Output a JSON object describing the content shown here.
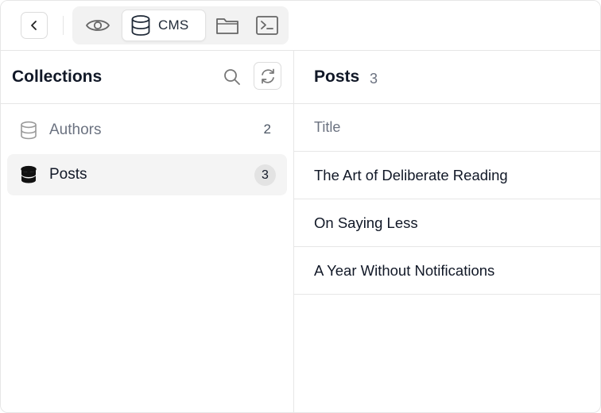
{
  "toolbar": {
    "tabs": [
      {
        "icon": "eye-icon",
        "label": ""
      },
      {
        "icon": "database-icon",
        "label": "CMS",
        "active": true
      },
      {
        "icon": "folder-icon",
        "label": ""
      },
      {
        "icon": "terminal-icon",
        "label": ""
      }
    ]
  },
  "sidebar": {
    "title": "Collections",
    "collections": [
      {
        "label": "Authors",
        "count": "2",
        "active": false
      },
      {
        "label": "Posts",
        "count": "3",
        "active": true
      }
    ]
  },
  "main": {
    "title": "Posts",
    "count": "3",
    "column_header": "Title",
    "rows": [
      {
        "title": "The Art of Deliberate Reading"
      },
      {
        "title": "On Saying Less"
      },
      {
        "title": "A Year Without Notifications"
      }
    ]
  },
  "colors": {
    "border": "#e6e6e6",
    "active_bg": "#f4f4f4",
    "text": "#111827",
    "muted": "#6b7280"
  }
}
